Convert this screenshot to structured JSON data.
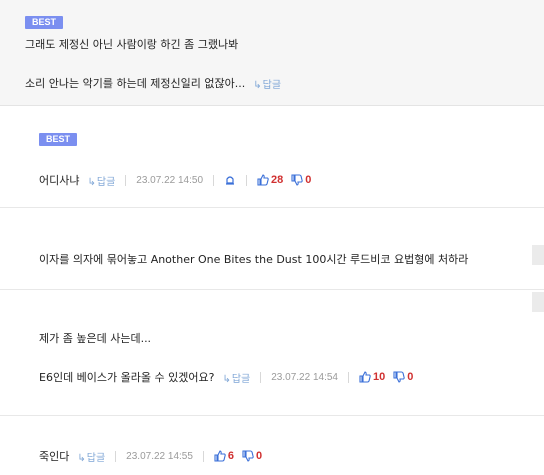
{
  "comments": [
    {
      "badge": "BEST",
      "line1": "그래도 제정신 아닌 사람이랑 하긴 좀 그랬나봐",
      "line2": "소리 안나는 악기를 하는데 제정신일리 없잖아...",
      "reply_label": "답글"
    },
    {
      "badge": "BEST",
      "text": "어디사냐",
      "reply_label": "답글",
      "date": "23.07.22 14:50",
      "likes": "28",
      "dislikes": "0"
    },
    {
      "text": "이자를 의자에 묶어놓고 Another One Bites the Dust 100시간 루드비코 요법형에 처하라"
    },
    {
      "line1": "제가 좀 높은데 사는데...",
      "line2": "E6인데 베이스가 올라올 수 있겠어요?",
      "reply_label": "답글",
      "date": "23.07.22 14:54",
      "likes": "10",
      "dislikes": "0"
    },
    {
      "text": "죽인다",
      "reply_label": "답글",
      "date": "23.07.22 14:55",
      "likes": "6",
      "dislikes": "0"
    }
  ],
  "colors": {
    "best_badge": "#7b8ff0",
    "reply_link": "#7fa6d6",
    "vote_count": "#d03030",
    "thumb_icon": "#3a6fd8"
  },
  "icons": {
    "reply": "reply-arrow-icon",
    "report": "report-bell-icon",
    "like": "thumbs-up-icon",
    "dislike": "thumbs-down-icon"
  }
}
